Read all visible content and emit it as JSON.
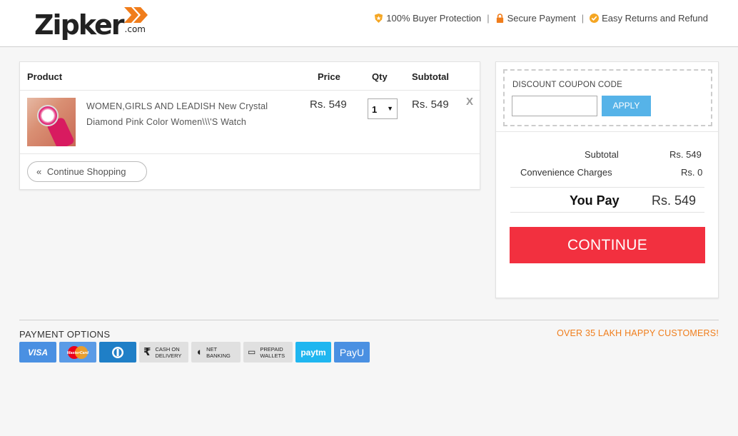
{
  "header": {
    "logo": {
      "name": "Zipker",
      "suffix": ".com"
    },
    "trust_badges": [
      {
        "icon": "shield-badge-icon",
        "label": "100% Buyer Protection"
      },
      {
        "icon": "lock-icon",
        "label": "Secure Payment"
      },
      {
        "icon": "check-circle-icon",
        "label": "Easy Returns and Refund"
      }
    ],
    "separator": "|"
  },
  "cart": {
    "columns": {
      "product": "Product",
      "price": "Price",
      "qty": "Qty",
      "subtotal": "Subtotal"
    },
    "items": [
      {
        "name": "WOMEN,GIRLS AND LEADISH New Crystal Diamond Pink Color Women\\\\\\'S Watch",
        "price": "Rs. 549",
        "qty": "1",
        "subtotal": "Rs. 549",
        "remove": "X"
      }
    ],
    "continue_shopping": "Continue Shopping"
  },
  "summary": {
    "coupon_label": "DISCOUNT COUPON CODE",
    "coupon_value": "",
    "apply_label": "APPLY",
    "rows": [
      {
        "label": "Subtotal",
        "value": "Rs. 549"
      },
      {
        "label": "Convenience Charges",
        "value": "Rs. 0"
      }
    ],
    "you_pay_label": "You Pay",
    "you_pay_value": "Rs. 549",
    "continue_label": "CONTINUE"
  },
  "footer": {
    "payment_title": "PAYMENT OPTIONS",
    "happy_customers": "OVER 35 LAKH HAPPY CUSTOMERS!",
    "payment_methods": [
      {
        "name": "VISA",
        "color": "#4a90e2"
      },
      {
        "name": "MasterCard",
        "color": "#5b9be6"
      },
      {
        "name": "Diners Club",
        "color": "#1f7fc7"
      },
      {
        "name": "CASH ON DELIVERY",
        "color": "#e0e0e0"
      },
      {
        "name": "NET BANKING",
        "color": "#e0e0e0"
      },
      {
        "name": "PREPAID WALLETS",
        "color": "#e0e0e0"
      },
      {
        "name": "paytm",
        "color": "#1fb6f0"
      },
      {
        "name": "PayU",
        "color": "#4a90e2"
      }
    ]
  },
  "colors": {
    "accent_orange": "#f07d1b",
    "continue_red": "#f2303f",
    "apply_blue": "#56b3e8"
  }
}
